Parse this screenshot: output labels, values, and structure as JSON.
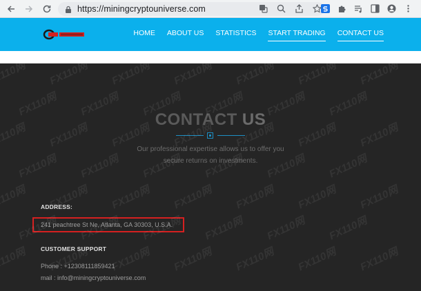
{
  "browser": {
    "url": "https://miningcryptouniverse.com"
  },
  "nav": {
    "items": [
      {
        "label": "HOME",
        "underlined": false
      },
      {
        "label": "ABOUT US",
        "underlined": false
      },
      {
        "label": "STATISTICS",
        "underlined": false
      },
      {
        "label": "START TRADING",
        "underlined": true
      },
      {
        "label": "CONTACT US",
        "underlined": true
      }
    ]
  },
  "contact": {
    "title_light": "CONTACT ",
    "title_bold": "US",
    "tagline_line1": "Our professional expertise allows us to offer you",
    "tagline_line2": "secure returns on investments.",
    "address_label": "ADDRESS:",
    "address": "241 peachtree St Ne, Atlanta, GA 30303, U.S.A.",
    "support_label": "CUSTOMER SUPPORT",
    "phone": "Phone : +12308111859421",
    "mail": "mail : info@miningcryptouniverse.com"
  },
  "watermark": {
    "text": "FX110网"
  },
  "colors": {
    "header": "#0bb0ec",
    "background": "#252525",
    "highlight": "#d62020",
    "accent": "#1d8fc4"
  }
}
